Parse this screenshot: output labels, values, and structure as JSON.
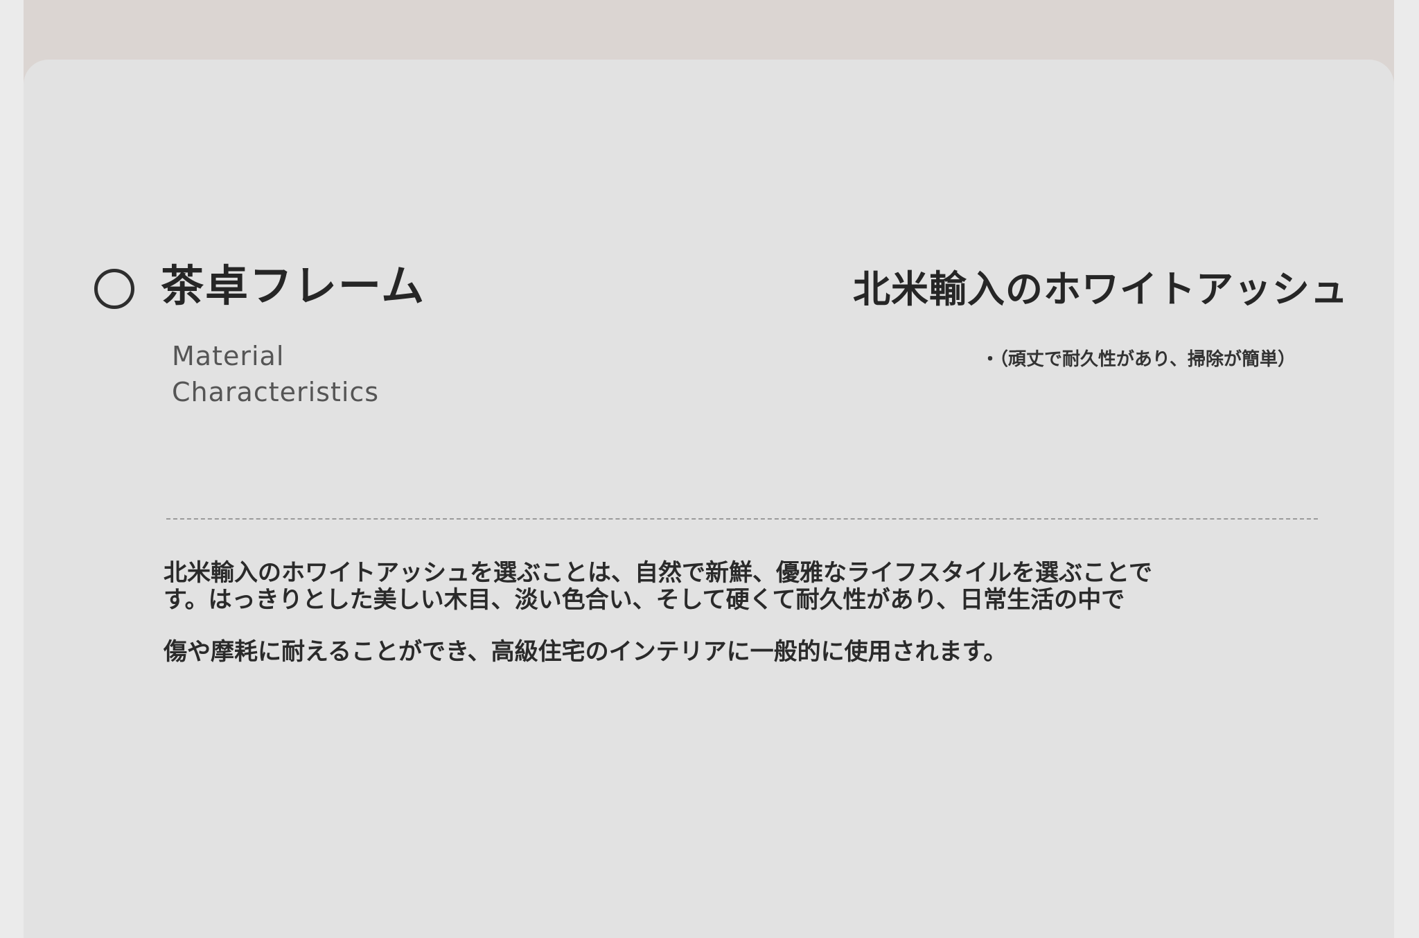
{
  "section": {
    "title": "茶卓フレーム",
    "subtitle": "Material Characteristics"
  },
  "material": {
    "name": "北米輸入のホワイトアッシュ",
    "note": "・（頑丈で耐久性があり、掃除が簡単）"
  },
  "description": {
    "paragraph_1": "北米輸入のホワイトアッシュを選ぶことは、自然で新鮮、優雅なライフスタイルを選ぶことです。はっきりとした美しい木目、淡い色合い、そして硬くて耐久性があり、日常生活の中で",
    "paragraph_2": "傷や摩耗に耐えることができ、高級住宅のインテリアに一般的に使用されます。"
  },
  "colors": {
    "background": "#ebebeb",
    "panel": "#e2e2e2",
    "top_band": "#dbd5d2",
    "text": "#262626"
  },
  "icons": {
    "title_marker": "circle-outline-icon"
  }
}
